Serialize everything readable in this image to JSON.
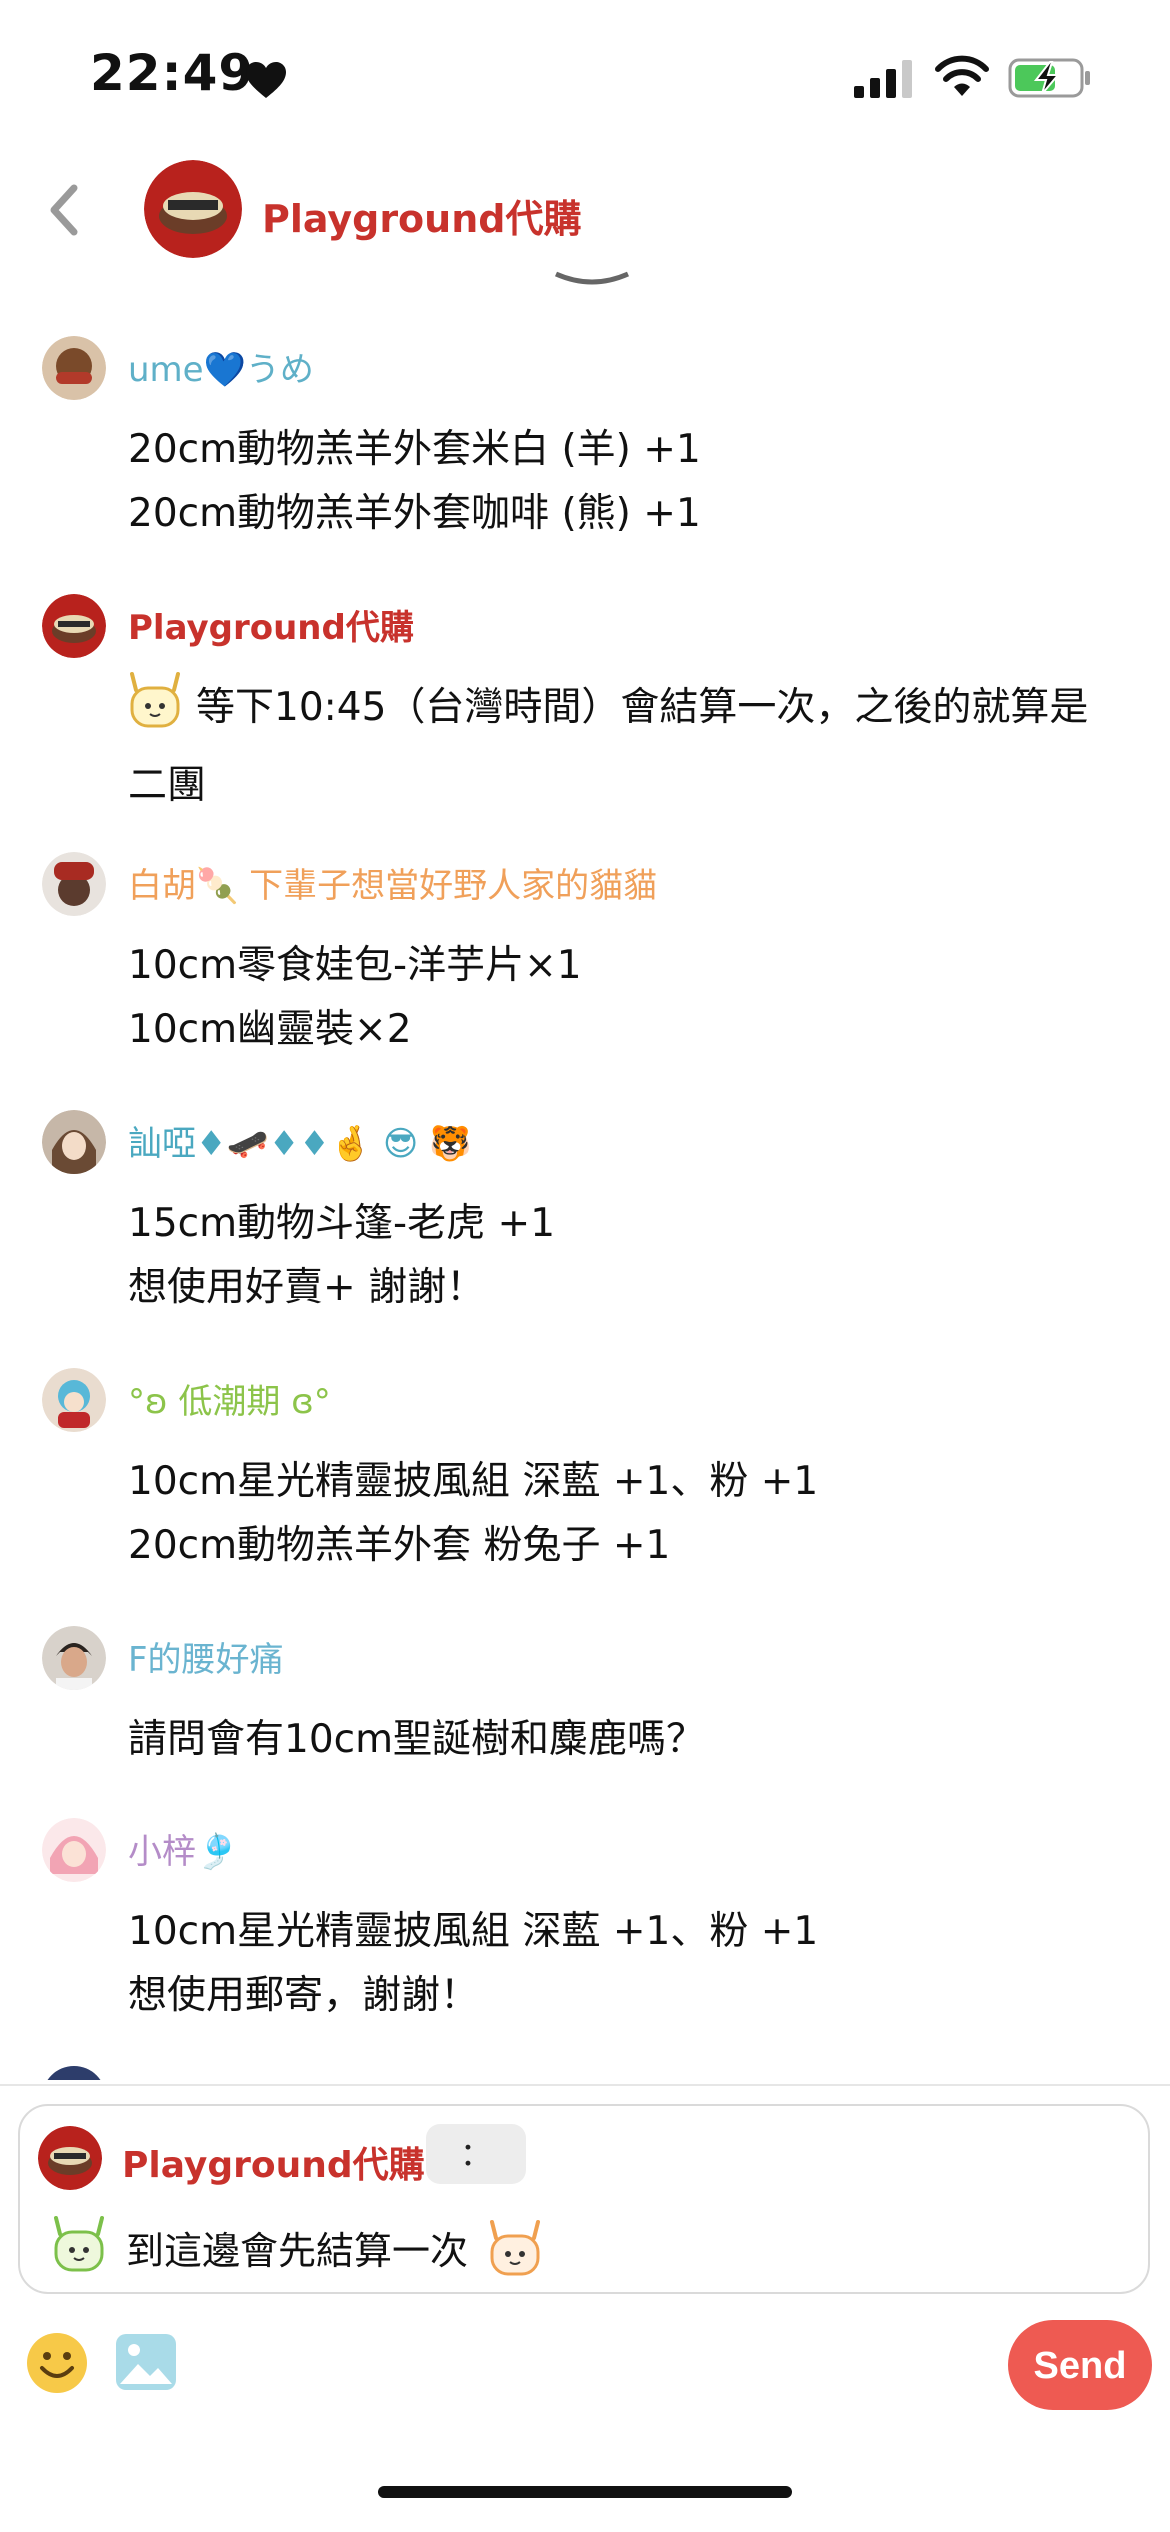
{
  "status_bar": {
    "time": "22:49",
    "icons": [
      "heart-icon",
      "cellular-signal-icon",
      "wifi-icon",
      "battery-charging-icon"
    ]
  },
  "header": {
    "back_icon": "chevron-left-icon",
    "title": "Playground代購"
  },
  "messages": [
    {
      "sender": "ume💙うめ",
      "sender_color": "#5fb0c8",
      "lines": [
        "20cm動物羔羊外套米白 (羊) +1",
        "20cm動物羔羊外套咖啡 (熊) +1"
      ]
    },
    {
      "sender": "Playground代購",
      "sender_color": "#c8322c",
      "lines": [
        "等下10:45（台灣時間）會結算一次，之後的就算是",
        "二團"
      ]
    },
    {
      "sender": "白胡🍡 下輩子想當好野人家的貓貓",
      "sender_color": "#f0a05a",
      "lines": [
        "10cm零食娃包-洋芋片×1",
        "10cm幽靈裝×2"
      ]
    },
    {
      "sender": "訕啞♦🛹♦♦🤞 😎 🐯",
      "sender_color": "#4aa8c0",
      "lines": [
        "15cm動物斗篷-老虎 +1",
        "想使用好賣+ 謝謝！"
      ]
    },
    {
      "sender": "°ʚ 低潮期 ɞ°",
      "sender_color": "#8cc44a",
      "lines": [
        "10cm星光精靈披風組 深藍 +1、粉 +1",
        "20cm動物羔羊外套 粉兔子 +1"
      ]
    },
    {
      "sender": "F的腰好痛",
      "sender_color": "#6ab4d0",
      "lines": [
        "請問會有10cm聖誕樹和麋鹿嗎？"
      ]
    },
    {
      "sender": "小梓🎐",
      "sender_color": "#b48cc8",
      "lines": [
        "10cm星光精靈披風組 深藍 +1、粉 +1",
        "想使用郵寄，謝謝！"
      ]
    }
  ],
  "reply": {
    "name": "Playground代購",
    "colon": "：",
    "text": "到這邊會先結算一次"
  },
  "toolbar": {
    "emoji_icon": "smiley-icon",
    "image_icon": "image-icon",
    "send_label": "Send"
  },
  "colors": {
    "brand_red": "#c8322c",
    "send_button": "#ee5a52"
  }
}
